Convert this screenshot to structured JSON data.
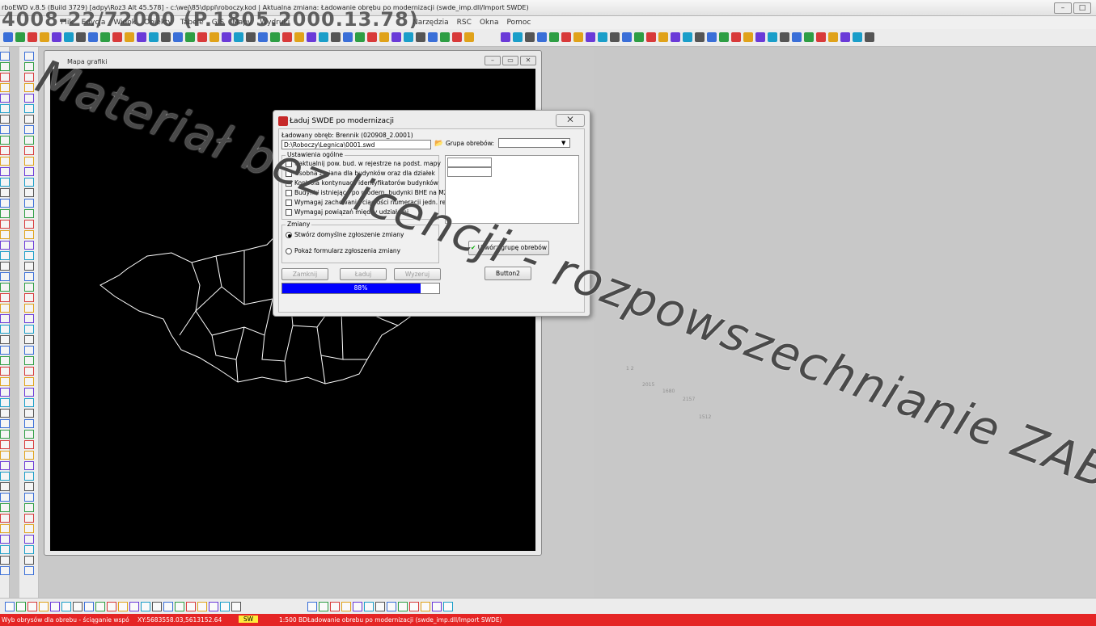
{
  "window": {
    "title": "rboEWD v.8.5 (Build 3729) [adpy\\Roz3 Alt 45.578] - c:\\wej\\85\\dppl\\roboczy.kod | Aktualna zmiana: Ładowanie obrębu po modernizacji (swde_imp.dll/Import SWDE)",
    "overlay_text": "4008-22/72000 (P.1805.2000.13.78)"
  },
  "menu": {
    "items": [
      "Plik",
      "Edycja",
      "Widok",
      "Obiekty",
      "Tabele",
      "GIS",
      "Mapy",
      "Wydruki"
    ],
    "items2": [
      "Narzędzia",
      "RSC",
      "Okna",
      "Pomoc"
    ]
  },
  "map_window": {
    "title": "Mapa grafiki"
  },
  "dialog": {
    "title": "Ładuj SWDE po modernizacji",
    "close": "⨉",
    "loaded_label": "Ładowany obręb: Brennik (020908_2.0001)",
    "file_path": "D:\\Roboczy\\Legnica\\0001.swd",
    "group_label": "Grupa obrebów:",
    "general_settings": "Ustawienia ogólne",
    "checkboxes": [
      "Uaktualnij pow. bud. w rejestrze na podst. mapy",
      "Osobna zmiana dla budynków oraz dla działek",
      "Kontrola kontynuacji identyfikatorów budynków",
      "Budynki istniejące po modern. budynki BHE na MZ",
      "Wymagaj zachowania ciągłości numeracji jedn. rej.",
      "Wymagaj powiązań między udziałami"
    ],
    "changes_label": "Zmiany",
    "radio1": "Stwórz domyślne zgłoszenie zmiany",
    "radio2": "Pokaż formularz zgłoszenia zmiany",
    "btn_close": "Zamknij",
    "btn_load": "Ładuj",
    "btn_export": "Wyzeruj",
    "progress_text": "88%",
    "progress_fraction": 0.88,
    "create_group_btn": "Utwórz grupę obrebów",
    "button2": "Button2"
  },
  "watermark": "Materiał bez licencji - rozpowszechnianie ZABRONIONE!",
  "status": {
    "left": "Wyb obrysów dla obrebu - ściąganie wspó",
    "coords": "XY:5683558.03,5613152.64",
    "mode": "SW",
    "scale": "1:500 BD",
    "message": "Ładowanie obrebu po modernizacji (swde_imp.dll/Import SWDE)"
  },
  "colors": {
    "status_bg": "#e52525",
    "progress": "#0000ff",
    "map_bg": "#000000"
  }
}
